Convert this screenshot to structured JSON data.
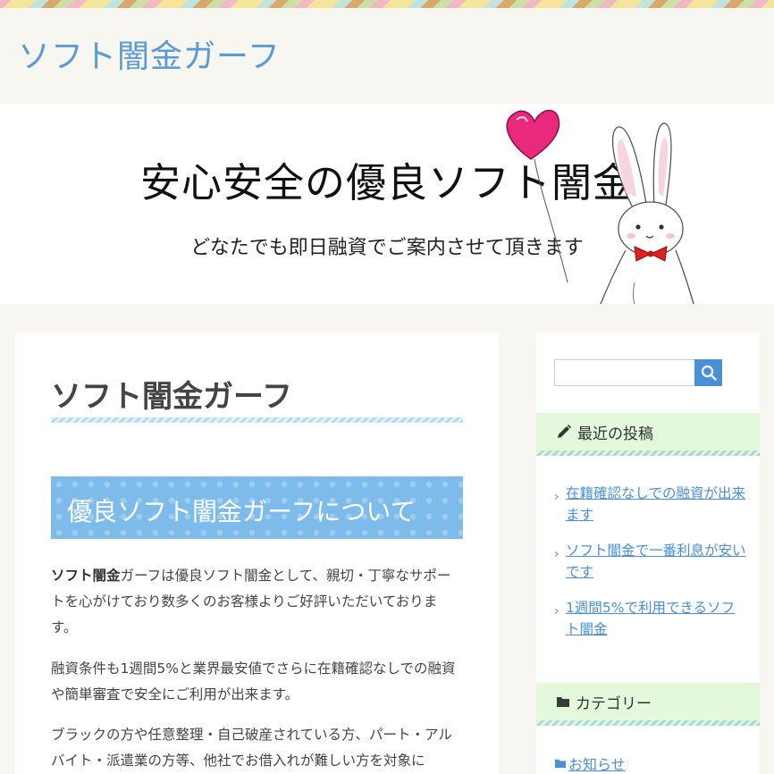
{
  "site": {
    "title": "ソフト闇金ガーフ"
  },
  "hero": {
    "title": "安心安全の優良ソフト闇金",
    "subtitle": "どなたでも即日融資でご案内させて頂きます"
  },
  "main": {
    "entry_title": "ソフト闇金ガーフ",
    "section_heading": "優良ソフト闇金ガーフについて",
    "paragraphs": [
      {
        "bold": "ソフト闇金",
        "text": "ガーフは優良ソフト闇金として、親切・丁寧なサポートを心がけており数多くのお客様よりご好評いただいております。"
      },
      {
        "text": "融資条件も1週間5%と業界最安値でさらに在籍確認なしでの融資や簡単審査で安全にご利用が出来ます。"
      },
      {
        "text": "ブラックの方や任意整理・自己破産されている方、パート・アルバイト・派遣業の方等、他社でお借入れが難しい方を対象に"
      }
    ]
  },
  "sidebar": {
    "search": {
      "placeholder": "",
      "icon": "search-icon"
    },
    "recent": {
      "heading": "最近の投稿",
      "icon": "pencil-icon",
      "items": [
        "在籍確認なしでの融資が出来ます",
        "ソフト闇金で一番利息が安いです",
        "1週間5%で利用できるソフト闇金"
      ]
    },
    "categories": {
      "heading": "カテゴリー",
      "icon": "folder-icon",
      "items": [
        "お知らせ"
      ]
    }
  },
  "colors": {
    "accent": "#4a90d9",
    "site_title": "#5b9bd5",
    "heading_box": "#7dbcea",
    "widget_head": "#e4f8dc"
  }
}
